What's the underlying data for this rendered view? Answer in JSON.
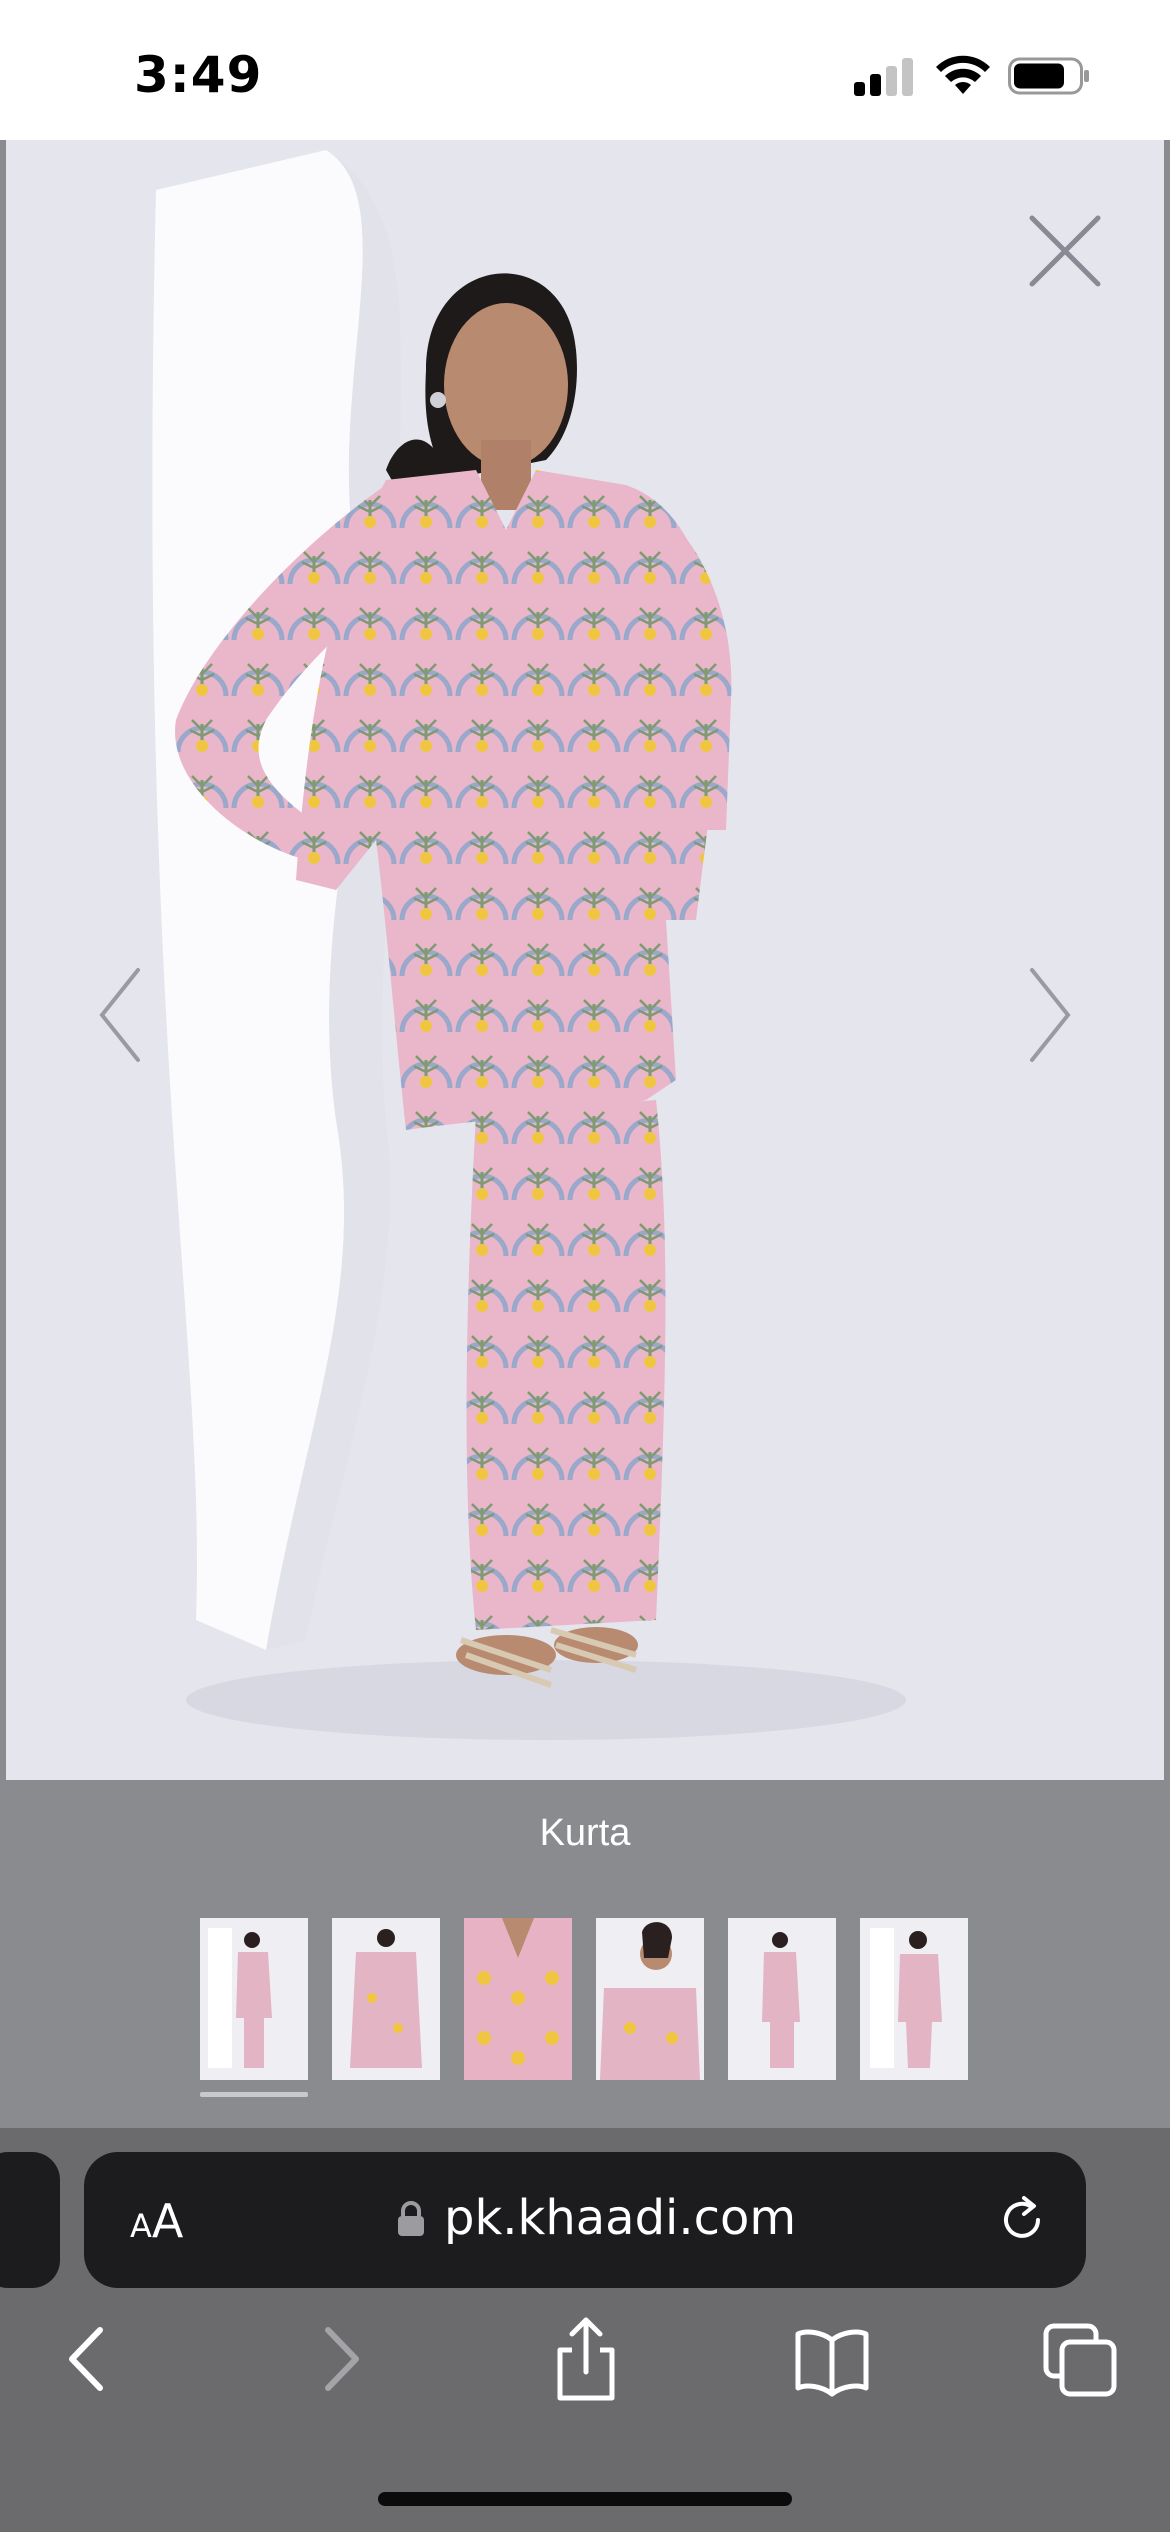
{
  "status_bar": {
    "time": "3:49"
  },
  "gallery": {
    "caption": "Kurta",
    "thumbnail_count": 6,
    "active_thumbnail": 1
  },
  "browser": {
    "text_size_label_small": "A",
    "text_size_label_large": "A",
    "url": "pk.khaadi.com"
  },
  "colors": {
    "status_bar_bg": "#ffffff",
    "gallery_bg": "#e7e7ef",
    "overlay_gray": "#8a8b8f",
    "toolbar_bg": "#6b6b6e",
    "address_bar_bg": "#1c1c1e",
    "fabric_pink": "#e8b5c8",
    "fabric_yellow": "#f0c640",
    "fabric_blue": "#9aa8cc"
  },
  "icons": [
    "close-icon",
    "chevron-left-icon",
    "chevron-right-icon",
    "lock-icon",
    "reload-icon",
    "back-icon",
    "forward-icon",
    "share-icon",
    "bookmarks-icon",
    "tabs-icon"
  ]
}
